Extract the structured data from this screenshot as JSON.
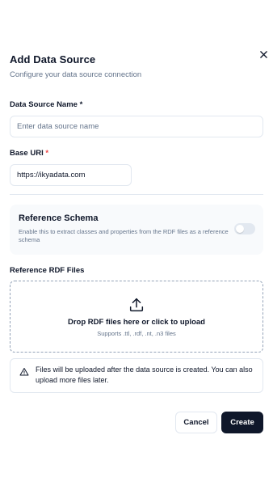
{
  "dialog": {
    "title": "Add Data Source",
    "subtitle": "Configure your data source connection",
    "close_icon": "close-icon"
  },
  "form": {
    "name": {
      "label": "Data Source Name *",
      "placeholder": "Enter data source name",
      "value": ""
    },
    "base_uri": {
      "label": "Base URI",
      "required_marker": "*",
      "value": "https://ikyadata.com"
    }
  },
  "reference_schema": {
    "title": "Reference Schema",
    "description": "Enable this to extract classes and properties from the RDF files as a reference schema",
    "enabled": false
  },
  "rdf_files": {
    "label": "Reference RDF Files",
    "icon": "upload-icon",
    "drop_text": "Drop RDF files here or click to upload",
    "supported_text": "Supports .ttl, .rdf, .nt, .n3 files"
  },
  "notice": {
    "icon": "warning-icon",
    "text": "Files will be uploaded after the data source is created. You can also upload more files later."
  },
  "actions": {
    "cancel_label": "Cancel",
    "create_label": "Create"
  },
  "colors": {
    "primary": "#0f172a",
    "muted": "#64748b",
    "border": "#e2e8f0",
    "required": "#ef4444",
    "card_bg": "#f8fafc"
  }
}
